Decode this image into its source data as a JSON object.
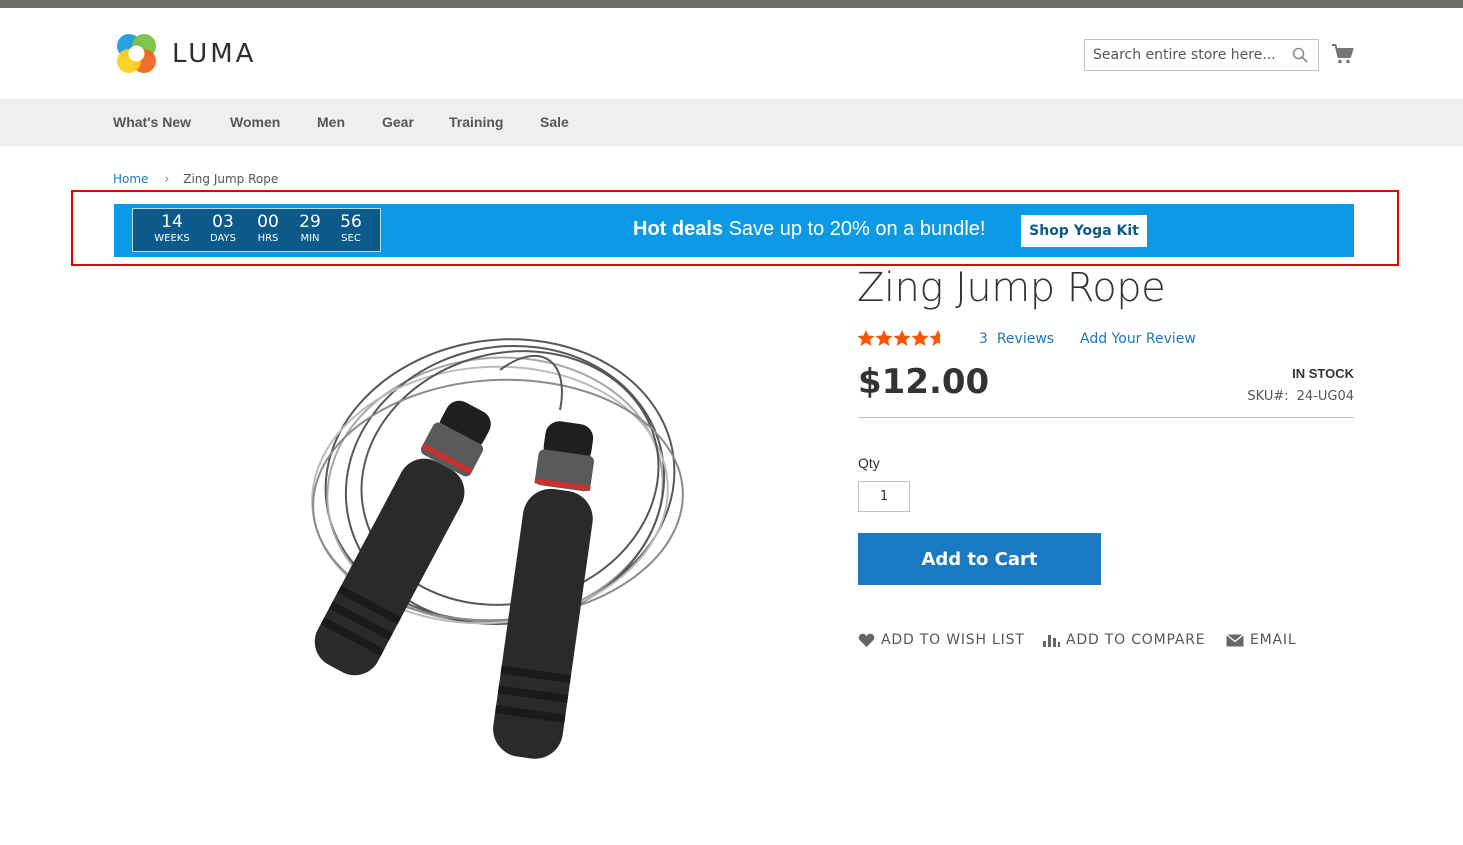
{
  "header": {
    "brand": "LUMA",
    "search_placeholder": "Search entire store here...",
    "cart_icon": "shopping-cart-icon"
  },
  "nav": {
    "items": [
      "What's New",
      "Women",
      "Men",
      "Gear",
      "Training",
      "Sale"
    ]
  },
  "breadcrumb": {
    "home": "Home",
    "separator": "›",
    "current": "Zing Jump Rope"
  },
  "promo_banner": {
    "countdown": [
      {
        "value": "14",
        "label": "WEEKS"
      },
      {
        "value": "03",
        "label": "DAYS"
      },
      {
        "value": "00",
        "label": "HRS"
      },
      {
        "value": "29",
        "label": "MIN"
      },
      {
        "value": "56",
        "label": "SEC"
      }
    ],
    "headline_bold": "Hot deals",
    "headline_text": "Save up to 20% on a bundle!",
    "button_label": "Shop Yoga Kit",
    "background_color": "#0c9ae6",
    "countdown_color": "#0b5a89"
  },
  "product": {
    "title": "Zing Jump Rope",
    "rating_stars": 4.6,
    "reviews_count": "3",
    "reviews_label": "Reviews",
    "add_review_label": "Add Your Review",
    "price": "$12.00",
    "stock_status": "IN STOCK",
    "sku_label": "SKU#:",
    "sku_value": "24-UG04",
    "qty_label": "Qty",
    "qty_value": "1",
    "add_to_cart_label": "Add to Cart",
    "actions": {
      "wishlist": "ADD TO WISH LIST",
      "compare": "ADD TO COMPARE",
      "email": "EMAIL"
    }
  },
  "colors": {
    "link": "#1979c3",
    "primary_button": "#1979c3",
    "star": "#ff5501",
    "highlight_border": "#e00000"
  }
}
